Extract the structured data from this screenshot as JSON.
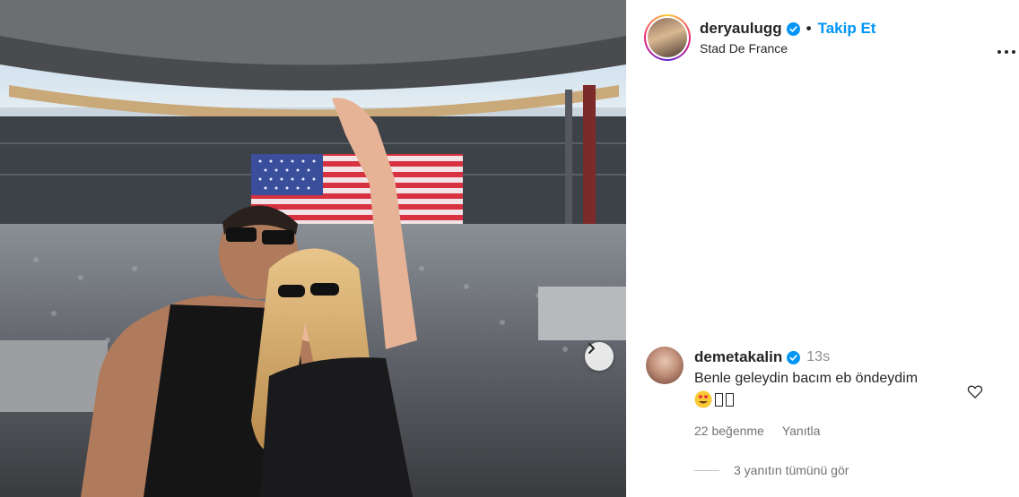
{
  "post": {
    "username": "deryaulugg",
    "separator": "•",
    "follow_label": "Takip Et",
    "location": "Stad De France"
  },
  "comment": {
    "username": "demetakalin",
    "time": "13s",
    "text": "Benle geleydin bacım eb öndeydim",
    "likes": "22 beğenme",
    "reply_label": "Yanıtla",
    "view_replies": "3 yanıtın tümünü gör"
  },
  "colors": {
    "accent": "#0095f6",
    "text": "#262626",
    "muted": "#737373"
  },
  "icons": [
    "verified-icon",
    "more-options-icon",
    "heart-icon",
    "next-arrow-icon",
    "heart-eyes-emoji"
  ]
}
